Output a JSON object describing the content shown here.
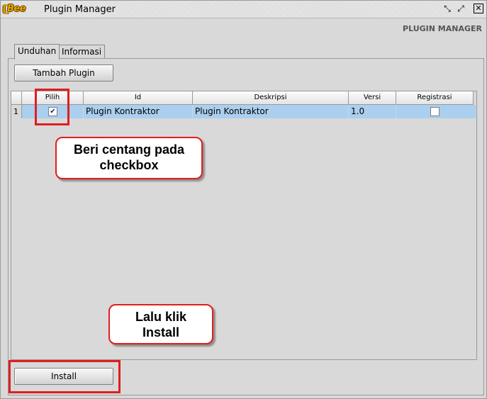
{
  "window": {
    "title": "Plugin Manager",
    "logo_text": "Bee",
    "header_label": "PLUGIN MANAGER"
  },
  "tabs": [
    {
      "label": "Unduhan",
      "active": true
    },
    {
      "label": "Informasi",
      "active": false
    }
  ],
  "toolbar": {
    "add_plugin_label": "Tambah Plugin"
  },
  "table": {
    "columns": [
      "Pilih",
      "Id",
      "Deskripsi",
      "Versi",
      "Registrasi"
    ],
    "rows": [
      {
        "num": "1",
        "pilih": true,
        "id": "Plugin Kontraktor",
        "deskripsi": "Plugin Kontraktor",
        "versi": "1.0",
        "registrasi": false
      }
    ]
  },
  "footer": {
    "install_label": "Install"
  },
  "annotations": {
    "checkbox_callout": [
      "Beri centang pada",
      "checkbox"
    ],
    "install_callout": [
      "Lalu klik",
      "Install"
    ]
  },
  "colors": {
    "selected_row": "#abcfee",
    "highlight_red": "#e01e1e",
    "panel_bg": "#d9d9d9"
  },
  "icons": {
    "restore": "restore-icon",
    "maximize": "maximize-icon",
    "close": "close-icon"
  }
}
